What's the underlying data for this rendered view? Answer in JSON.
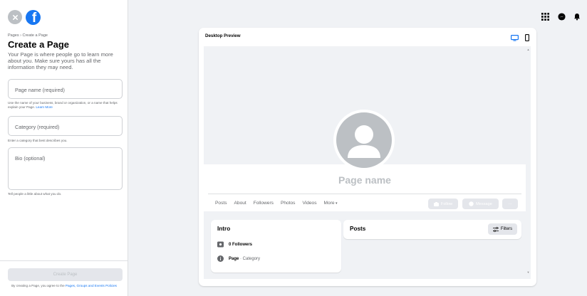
{
  "left_panel": {
    "breadcrumb": "Pages › Create a Page",
    "title": "Create a Page",
    "description": "Your Page is where people go to learn more about you. Make sure yours has all the information they may need.",
    "page_name_placeholder": "Page name (required)",
    "page_name_helper": "Use the name of your business, brand or organization, or a name that helps explain your Page.",
    "learn_more": "Learn More",
    "category_placeholder": "Category (required)",
    "category_helper": "Enter a category that best describes you.",
    "bio_placeholder": "Bio (optional)",
    "bio_helper": "Tell people a little about what you do.",
    "create_button": "Create Page",
    "agree_prefix": "By creating a Page, you agree to the",
    "agree_links": "Pages, Groups and Events Policies"
  },
  "preview": {
    "title": "Desktop Preview",
    "page_name": "Page name",
    "tabs": [
      "Posts",
      "About",
      "Followers",
      "Photos",
      "Videos",
      "More"
    ],
    "follow_button": "Follow",
    "message_button": "Message",
    "more_button": "···",
    "intro_title": "Intro",
    "followers_count": "0 Followers",
    "page_label": "Page",
    "category_suffix": " · Category",
    "posts_title": "Posts",
    "filters_button": "Filters"
  },
  "icons": {
    "close": "close-icon",
    "logo": "facebook-logo",
    "menu": "grid-menu-icon",
    "messenger": "messenger-icon",
    "notifications": "bell-icon",
    "desktop": "desktop-icon",
    "mobile": "mobile-icon"
  },
  "colors": {
    "brand": "#1877f2",
    "background": "#f0f2f5"
  }
}
